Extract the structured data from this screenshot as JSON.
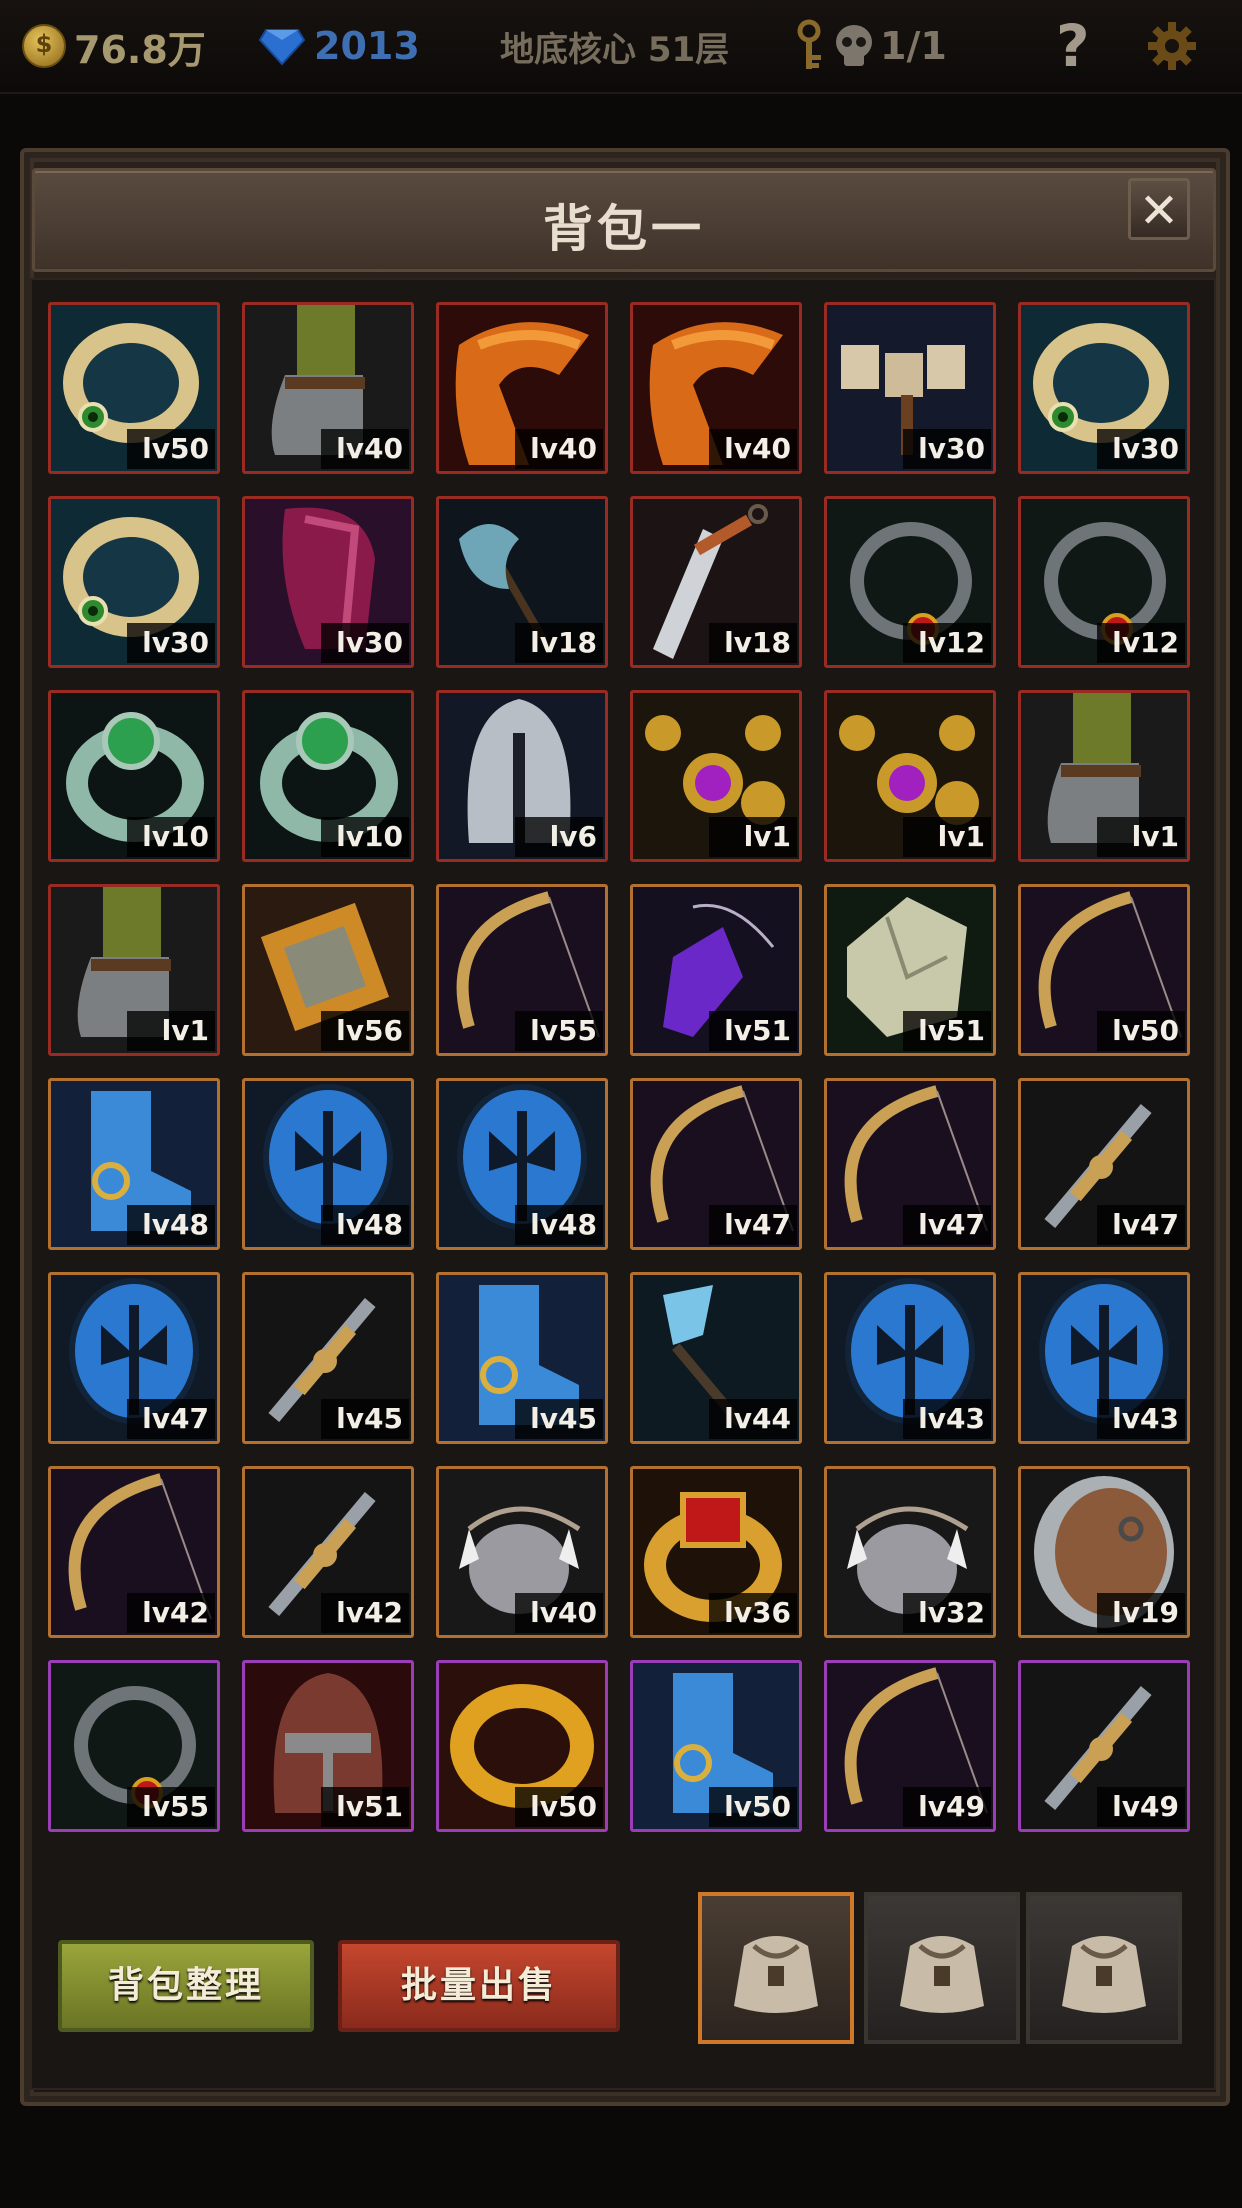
{
  "topbar": {
    "gold": "76.8万",
    "gems": "2013",
    "location": "地底核心 51层",
    "keys_icon": "key-icon",
    "skull": "1/1",
    "help": "?",
    "settings_icon": "gear-icon"
  },
  "window": {
    "title": "背包一",
    "close": "✕"
  },
  "items": [
    {
      "icon": "ring-gold-eye",
      "level": "lv50",
      "rarity": "red"
    },
    {
      "icon": "boot-green",
      "level": "lv40",
      "rarity": "red"
    },
    {
      "icon": "cape-orange",
      "level": "lv40",
      "rarity": "red"
    },
    {
      "icon": "cape-orange",
      "level": "lv40",
      "rarity": "red"
    },
    {
      "icon": "hammer-stone",
      "level": "lv30",
      "rarity": "red"
    },
    {
      "icon": "ring-gold-eye",
      "level": "lv30",
      "rarity": "red"
    },
    {
      "icon": "ring-gold-eye",
      "level": "lv30",
      "rarity": "red"
    },
    {
      "icon": "armor-crimson",
      "level": "lv30",
      "rarity": "red"
    },
    {
      "icon": "axe-blue",
      "level": "lv18",
      "rarity": "red"
    },
    {
      "icon": "dagger-bronze",
      "level": "lv18",
      "rarity": "red"
    },
    {
      "icon": "ring-iron-ruby",
      "level": "lv12",
      "rarity": "red"
    },
    {
      "icon": "ring-iron-ruby",
      "level": "lv12",
      "rarity": "red"
    },
    {
      "icon": "ring-jade",
      "level": "lv10",
      "rarity": "red"
    },
    {
      "icon": "ring-jade",
      "level": "lv10",
      "rarity": "red"
    },
    {
      "icon": "helmet-steel",
      "level": "lv6",
      "rarity": "red"
    },
    {
      "icon": "amulet-gold",
      "level": "lv1",
      "rarity": "red"
    },
    {
      "icon": "amulet-gold",
      "level": "lv1",
      "rarity": "red"
    },
    {
      "icon": "boot-green",
      "level": "lv1",
      "rarity": "red"
    },
    {
      "icon": "boot-green",
      "level": "lv1",
      "rarity": "red"
    },
    {
      "icon": "gauntlet-gold",
      "level": "lv56",
      "rarity": "orange"
    },
    {
      "icon": "bow-gold",
      "level": "lv55",
      "rarity": "orange"
    },
    {
      "icon": "crystal-pendant",
      "level": "lv51",
      "rarity": "orange"
    },
    {
      "icon": "stone-shard",
      "level": "lv51",
      "rarity": "orange"
    },
    {
      "icon": "bow-gold",
      "level": "lv50",
      "rarity": "orange"
    },
    {
      "icon": "boot-blue",
      "level": "lv48",
      "rarity": "orange"
    },
    {
      "icon": "shield-blue",
      "level": "lv48",
      "rarity": "orange"
    },
    {
      "icon": "shield-blue",
      "level": "lv48",
      "rarity": "orange"
    },
    {
      "icon": "bow-gold",
      "level": "lv47",
      "rarity": "orange"
    },
    {
      "icon": "bow-gold",
      "level": "lv47",
      "rarity": "orange"
    },
    {
      "icon": "sword-gold",
      "level": "lv47",
      "rarity": "orange"
    },
    {
      "icon": "shield-blue",
      "level": "lv47",
      "rarity": "orange"
    },
    {
      "icon": "sword-gold",
      "level": "lv45",
      "rarity": "orange"
    },
    {
      "icon": "boot-blue",
      "level": "lv45",
      "rarity": "orange"
    },
    {
      "icon": "staff-crystal",
      "level": "lv44",
      "rarity": "orange"
    },
    {
      "icon": "shield-blue",
      "level": "lv43",
      "rarity": "orange"
    },
    {
      "icon": "shield-blue",
      "level": "lv43",
      "rarity": "orange"
    },
    {
      "icon": "bow-gold",
      "level": "lv42",
      "rarity": "orange"
    },
    {
      "icon": "sword-gold",
      "level": "lv42",
      "rarity": "orange"
    },
    {
      "icon": "fang-necklace",
      "level": "lv40",
      "rarity": "orange"
    },
    {
      "icon": "ring-ruby-gold",
      "level": "lv36",
      "rarity": "orange"
    },
    {
      "icon": "fang-necklace",
      "level": "lv32",
      "rarity": "orange"
    },
    {
      "icon": "shield-wood",
      "level": "lv19",
      "rarity": "orange"
    },
    {
      "icon": "ring-iron-ruby",
      "level": "lv55",
      "rarity": "purple"
    },
    {
      "icon": "helmet-red",
      "level": "lv51",
      "rarity": "purple"
    },
    {
      "icon": "ring-gold-plain",
      "level": "lv50",
      "rarity": "purple"
    },
    {
      "icon": "boot-blue",
      "level": "lv50",
      "rarity": "purple"
    },
    {
      "icon": "bow-gold",
      "level": "lv49",
      "rarity": "purple"
    },
    {
      "icon": "sword-gold",
      "level": "lv49",
      "rarity": "purple"
    }
  ],
  "buttons": {
    "sort": "背包整理",
    "bulk_sell": "批量出售"
  },
  "bag_tabs": [
    {
      "icon": "bag-icon",
      "active": true
    },
    {
      "icon": "bag-icon",
      "active": false
    },
    {
      "icon": "bag-icon",
      "active": false
    }
  ],
  "colors": {
    "rarity_red": "#9a2b22",
    "rarity_orange": "#b4702f",
    "rarity_purple": "#9a3db6"
  }
}
